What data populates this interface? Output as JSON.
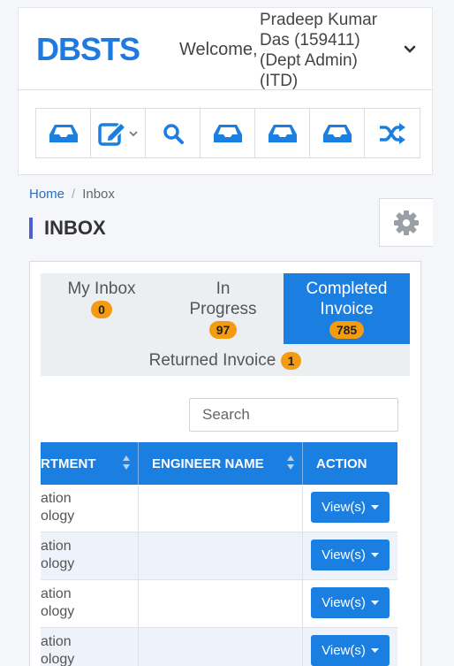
{
  "app": {
    "brand": "DBSTS",
    "welcome": "Welcome,",
    "user_lines": [
      "Pradeep Kumar",
      "Das (159411)",
      "(Dept Admin)",
      "(ITD)"
    ]
  },
  "toolbar": {
    "icons": [
      "inbox-icon",
      "edit-icon",
      "search-icon",
      "inbox-icon",
      "inbox-icon",
      "inbox-icon",
      "shuffle-icon"
    ]
  },
  "breadcrumb": {
    "home": "Home",
    "separator": "/",
    "current": "Inbox"
  },
  "page_title": "INBOX",
  "tabs": {
    "my_inbox": {
      "label": "My Inbox",
      "count": "0"
    },
    "in_progress": {
      "label_line1": "In",
      "label_line2": "Progress",
      "count": "97"
    },
    "completed": {
      "label_line1": "Completed",
      "label_line2": "Invoice",
      "count": "785"
    },
    "returned": {
      "label": "Returned Invoice",
      "count": "1"
    }
  },
  "search": {
    "placeholder": "Search"
  },
  "table": {
    "headers": [
      "RTMENT",
      "ENGINEER NAME",
      "ACTION"
    ],
    "rows": [
      {
        "dept_line1": "ation",
        "dept_line2": "ology",
        "engineer": "",
        "action": "View(s)"
      },
      {
        "dept_line1": "ation",
        "dept_line2": "ology",
        "engineer": "",
        "action": "View(s)"
      },
      {
        "dept_line1": "ation",
        "dept_line2": "ology",
        "engineer": "",
        "action": "View(s)"
      },
      {
        "dept_line1": "ation",
        "dept_line2": "ology",
        "engineer": "",
        "action": "View(s)"
      }
    ]
  },
  "colors": {
    "primary": "#1a7fe0",
    "brand": "#1f7ae0",
    "badge": "#f39c12",
    "title_accent": "#4a5fd1"
  }
}
